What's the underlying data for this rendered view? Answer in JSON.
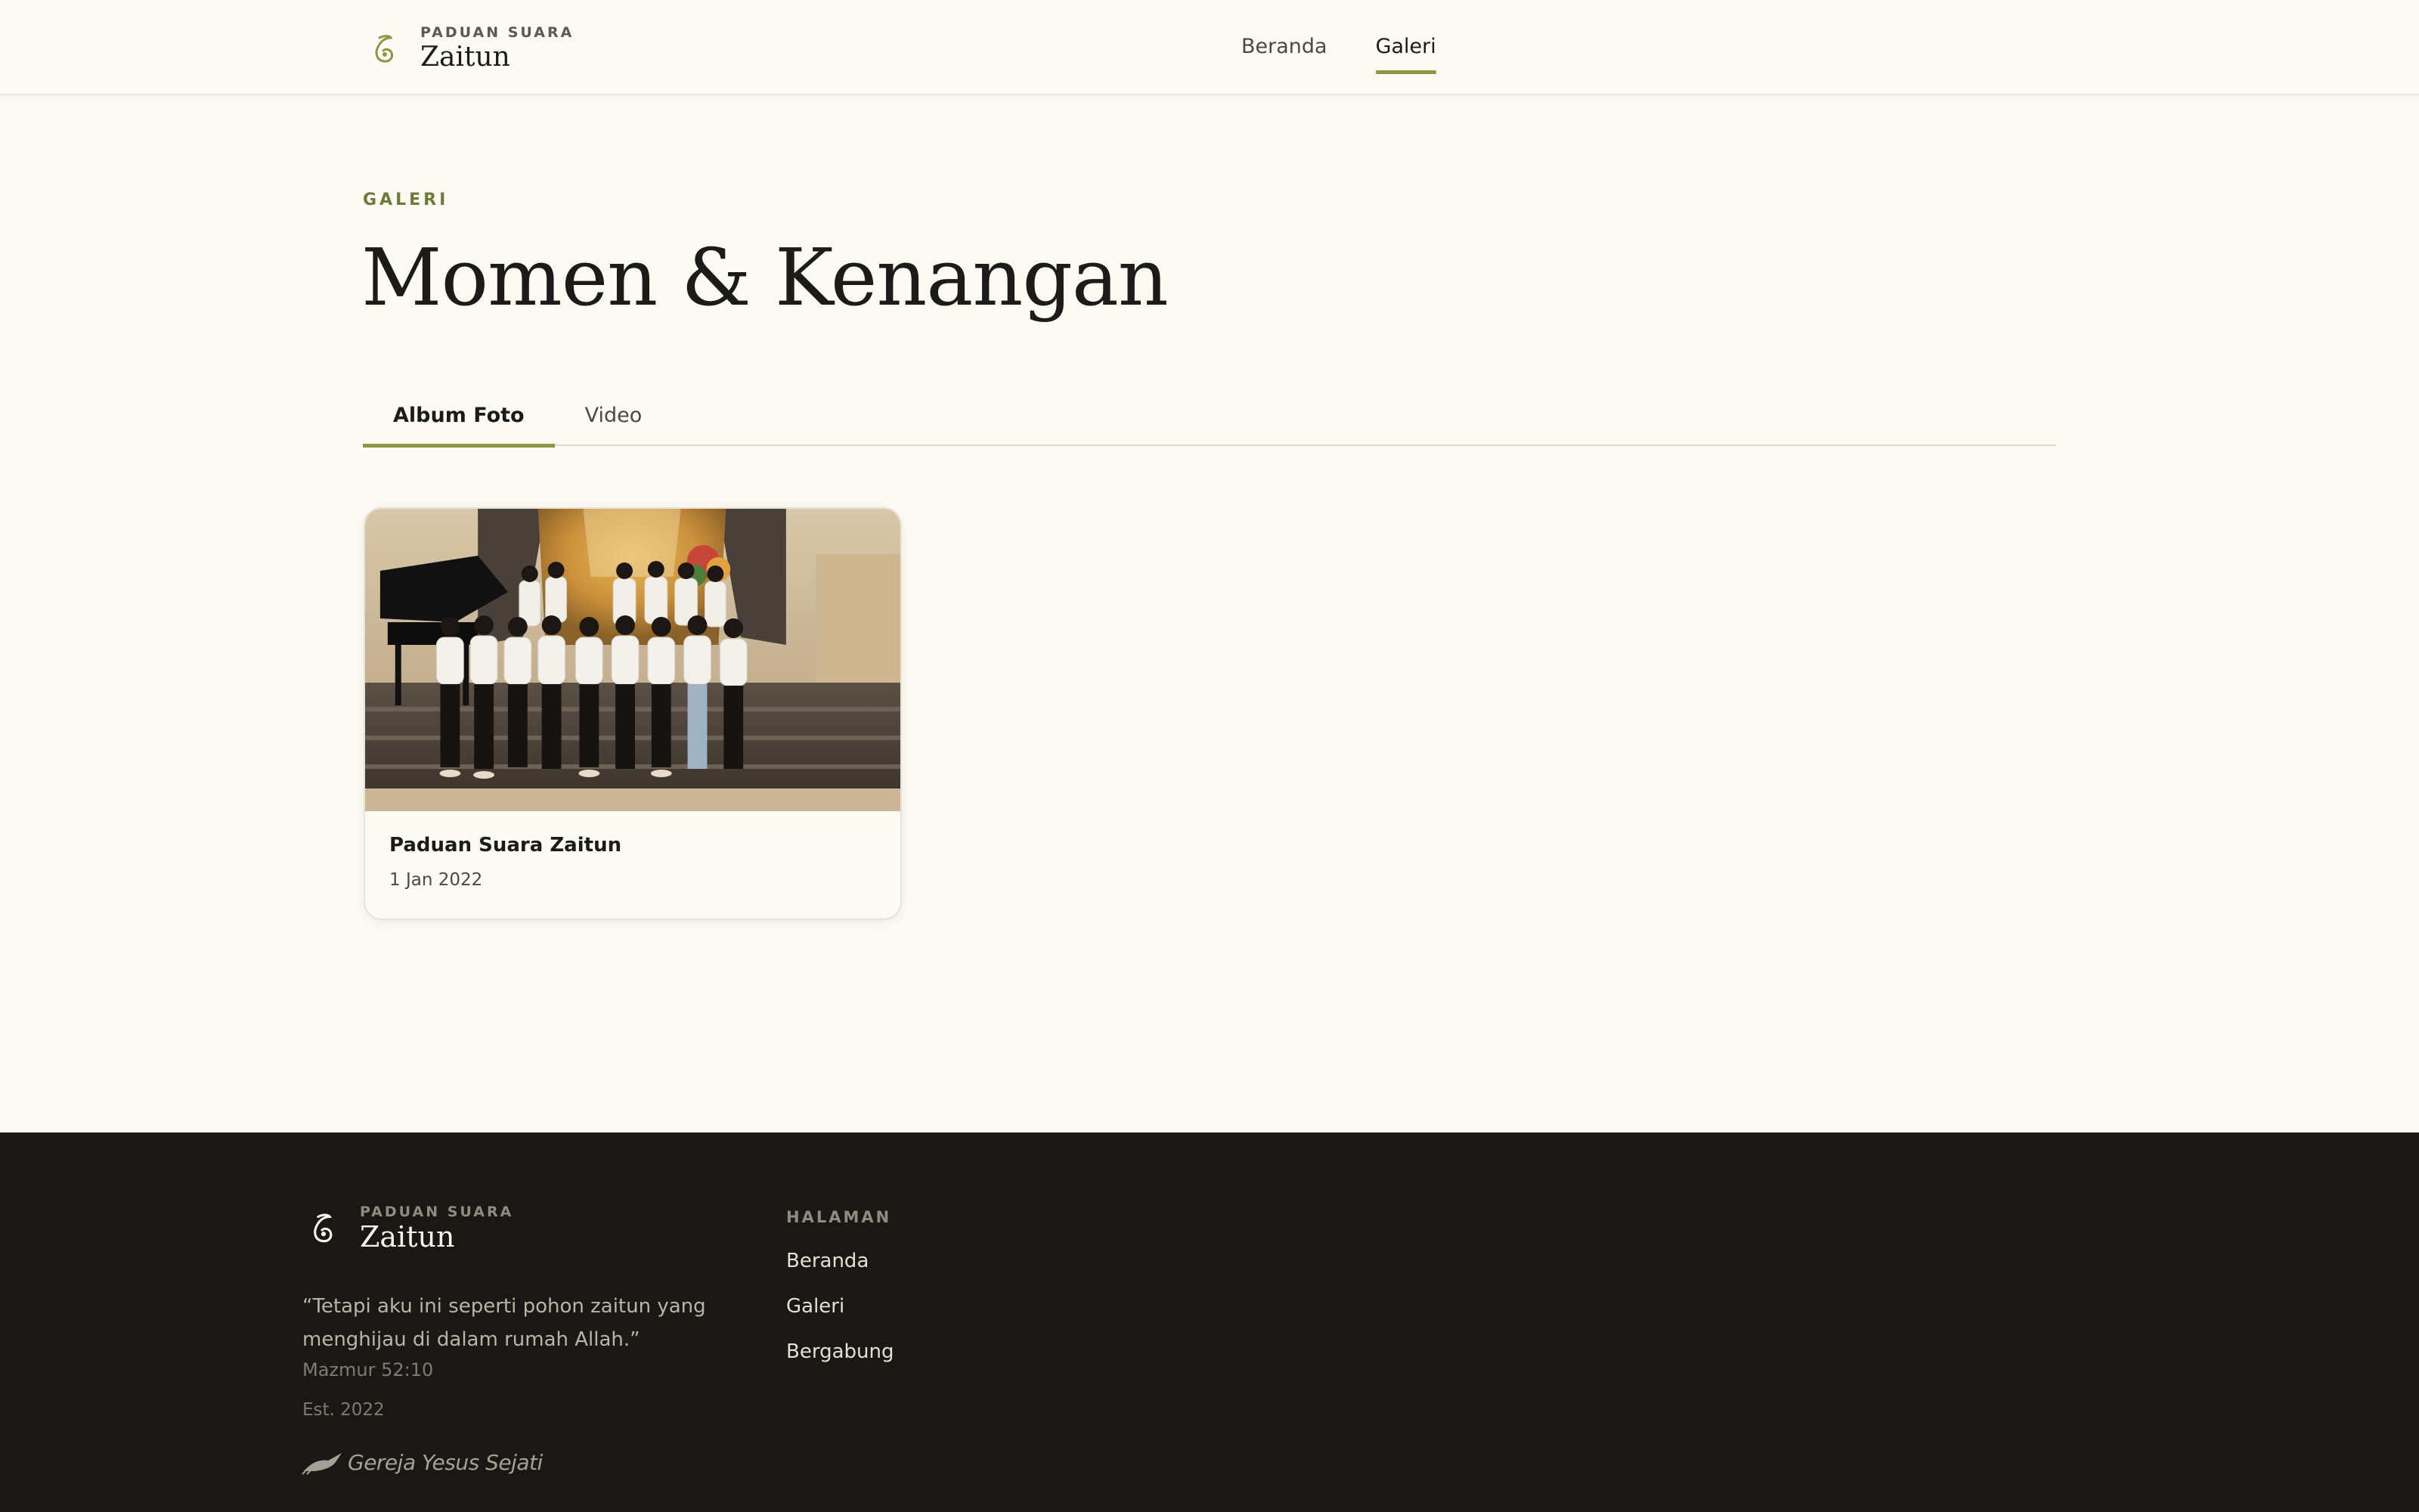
{
  "brand": {
    "kicker": "PADUAN SUARA",
    "name": "Zaitun",
    "accent_color": "#8a9a44",
    "icon": "olive-leaf-icon"
  },
  "nav": {
    "items": [
      {
        "label": "Beranda",
        "active": false
      },
      {
        "label": "Galeri",
        "active": true
      }
    ]
  },
  "page": {
    "kicker": "GALERI",
    "title": "Momen & Kenangan"
  },
  "tabs": [
    {
      "label": "Album Foto",
      "active": true
    },
    {
      "label": "Video",
      "active": false
    }
  ],
  "albums": [
    {
      "title": "Paduan Suara Zaitun",
      "date": "1 Jan 2022",
      "photo": "choir-group-photo"
    }
  ],
  "footer": {
    "brand_kicker": "PADUAN SUARA",
    "brand_name": "Zaitun",
    "quote": "“Tetapi aku ini seperti pohon zaitun yang menghijau di dalam rumah Allah.”",
    "quote_ref": "Mazmur 52:10",
    "est": "Est. 2022",
    "church_logo_text": "Gereja Yesus Sejati",
    "links_heading": "HALAMAN",
    "links": [
      "Beranda",
      "Galeri",
      "Bergabung"
    ],
    "background": "#191814"
  }
}
